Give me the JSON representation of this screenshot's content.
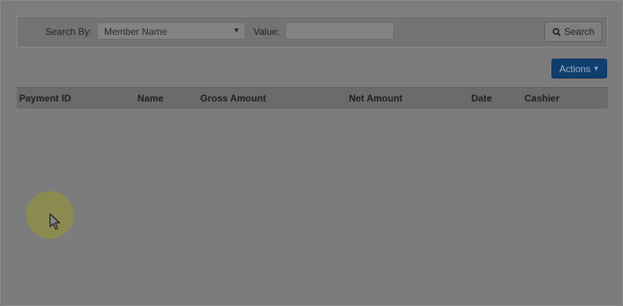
{
  "search": {
    "search_by_label": "Search By:",
    "selected_field": "Member Name",
    "value_label": "Value:",
    "value_text": "",
    "search_button_label": "Search"
  },
  "toolbar": {
    "actions_label": "Actions"
  },
  "table": {
    "columns": [
      "Payment ID",
      "Name",
      "Gross Amount",
      "Net Amount",
      "Date",
      "Cashier"
    ],
    "rows": []
  },
  "icons": {
    "search": "search-icon",
    "select_caret": "chevron-down-icon",
    "actions_caret": "chevron-down-icon",
    "cursor": "mouse-pointer-icon"
  },
  "colors": {
    "actions_button": "#0f3f6e",
    "overlay": "#7c7c7c",
    "cursor_highlight": "#8b8a4f"
  }
}
